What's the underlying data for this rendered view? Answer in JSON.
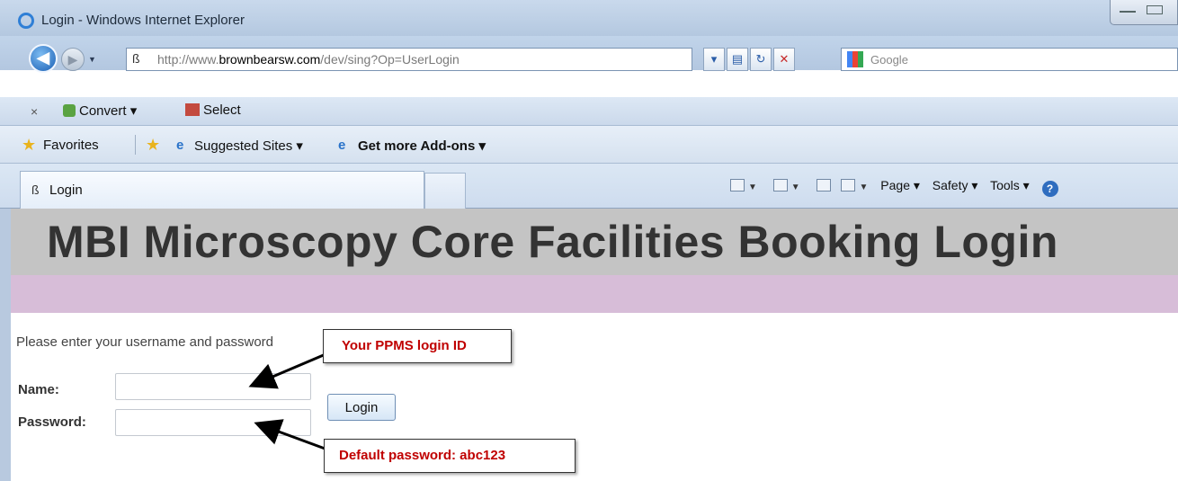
{
  "window": {
    "title": "Login - Windows Internet Explorer"
  },
  "addressbar": {
    "url_prefix": "http://www.",
    "url_domain": "brownbearsw.com",
    "url_path": "/dev/sing?Op=UserLogin",
    "search_placeholder": "Google"
  },
  "commandbar": {
    "close": "×",
    "convert_label": "Convert ▾",
    "select_label": "Select"
  },
  "favorites": {
    "favorites_label": "Favorites",
    "suggested_label": "Suggested Sites ▾",
    "addons_label": "Get more Add-ons ▾"
  },
  "tabs": {
    "active_tab_label": "Login"
  },
  "tools": {
    "page_label": "Page",
    "safety_label": "Safety",
    "tools_label": "Tools",
    "help_glyph": "?"
  },
  "page": {
    "heading": "MBI Microscopy Core Facilities Booking Login",
    "prompt": "Please enter your username and password",
    "name_label": "Name:",
    "password_label": "Password:",
    "name_value": "",
    "password_value": "",
    "login_button": "Login"
  },
  "annotations": {
    "login_id_note": "Your PPMS login ID",
    "default_password_note": "Default password: abc123"
  },
  "colors": {
    "banner": "#c4c4c4",
    "band": "#d7bdd8",
    "callout_text": "#c00000"
  }
}
